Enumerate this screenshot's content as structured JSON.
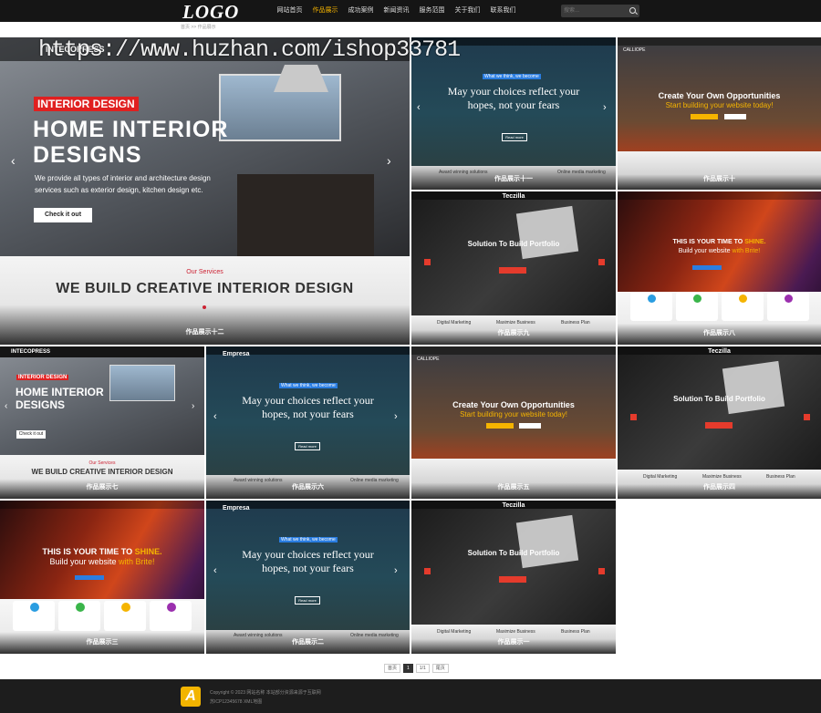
{
  "header": {
    "logo": "LOGO",
    "nav": [
      {
        "label": "网站首页"
      },
      {
        "label": "作品展示",
        "active": true
      },
      {
        "label": "成功案例"
      },
      {
        "label": "新闻资讯"
      },
      {
        "label": "服务范围"
      },
      {
        "label": "关于我们"
      },
      {
        "label": "联系我们"
      }
    ],
    "search_placeholder": "搜索..."
  },
  "breadcrumb": "首页 >> 作品展示",
  "watermark": "https://www.huzhan.com/ishop33781",
  "colors": {
    "accent": "#f5b400",
    "red": "#e02020"
  },
  "hero": {
    "brand": "INTECOPRESS",
    "badge": "INTERIOR DESIGN",
    "title_line1": "HOME INTERIOR",
    "title_line2": "DESIGNS",
    "desc_line1": "We provide all types of interior and architecture design",
    "desc_line2": "services such as exterior design, kitchen design etc.",
    "button": "Check it out",
    "services_label": "Our Services",
    "services_title": "WE BUILD CREATIVE INTERIOR DESIGN",
    "caption": "作品展示十二"
  },
  "tiles": [
    {
      "caption": "作品展示十一",
      "tag": "What we think, we become",
      "line1": "May your choices reflect your",
      "line2": "hopes, not your fears",
      "button": "Read more",
      "features": [
        "Award winning solutions",
        "Online media marketing"
      ]
    },
    {
      "caption": "作品展示十",
      "brand": "CALLIOPE",
      "title": "Create Your Own Opportunities",
      "subtitle": "Start building your website today!"
    },
    {
      "caption": "作品展示九",
      "brand": "Teczilla",
      "title": "Solution To Build Portfolio",
      "features": [
        "Digital Marketing",
        "Maximize Business",
        "Business Plan"
      ]
    },
    {
      "caption": "作品展示八",
      "line1": "THIS IS YOUR TIME TO",
      "highlight1": "SHINE.",
      "line2": "Build your website",
      "highlight2": "with Brite!"
    },
    {
      "caption": "作品展示七",
      "brand": "INTECOPRESS",
      "badge": "INTERIOR DESIGN",
      "title_line1": "HOME INTERIOR",
      "title_line2": "DESIGNS",
      "button": "Check it out",
      "services_label": "Our Services",
      "services_title": "WE BUILD CREATIVE INTERIOR DESIGN"
    },
    {
      "caption": "作品展示六",
      "brand": "Empresa",
      "tag": "What we think, we become",
      "line1": "May your choices reflect your",
      "line2": "hopes, not your fears",
      "button": "Read more",
      "features": [
        "Award winning solutions",
        "Online media marketing"
      ]
    },
    {
      "caption": "作品展示五",
      "brand": "CALLIOPE",
      "title": "Create Your Own Opportunities",
      "subtitle": "Start building your website today!"
    },
    {
      "caption": "作品展示四",
      "brand": "Teczilla",
      "title": "Solution To Build Portfolio",
      "features": [
        "Digital Marketing",
        "Maximize Business",
        "Business Plan"
      ]
    },
    {
      "caption": "作品展示三",
      "line1": "THIS IS YOUR TIME TO",
      "highlight1": "SHINE.",
      "line2": "Build your website",
      "highlight2": "with Brite!"
    },
    {
      "caption": "作品展示二",
      "brand": "Empresa",
      "tag": "What we think, we become",
      "line1": "May your choices reflect your",
      "line2": "hopes, not your fears",
      "button": "Read more",
      "features": [
        "Award winning solutions",
        "Online media marketing"
      ]
    },
    {
      "caption": "作品展示一",
      "brand": "Teczilla",
      "title": "Solution To Build Portfolio",
      "features": [
        "Digital Marketing",
        "Maximize Business",
        "Business Plan"
      ]
    }
  ],
  "pagination": {
    "first": "首页",
    "current": "1",
    "total": "1/1",
    "last": "尾页"
  },
  "footer": {
    "copyright": "Copyright © 2023 网站名称 本站部分资源来源于互联网",
    "icp": "苏ICP12345678 XML地图",
    "logo": "A"
  }
}
